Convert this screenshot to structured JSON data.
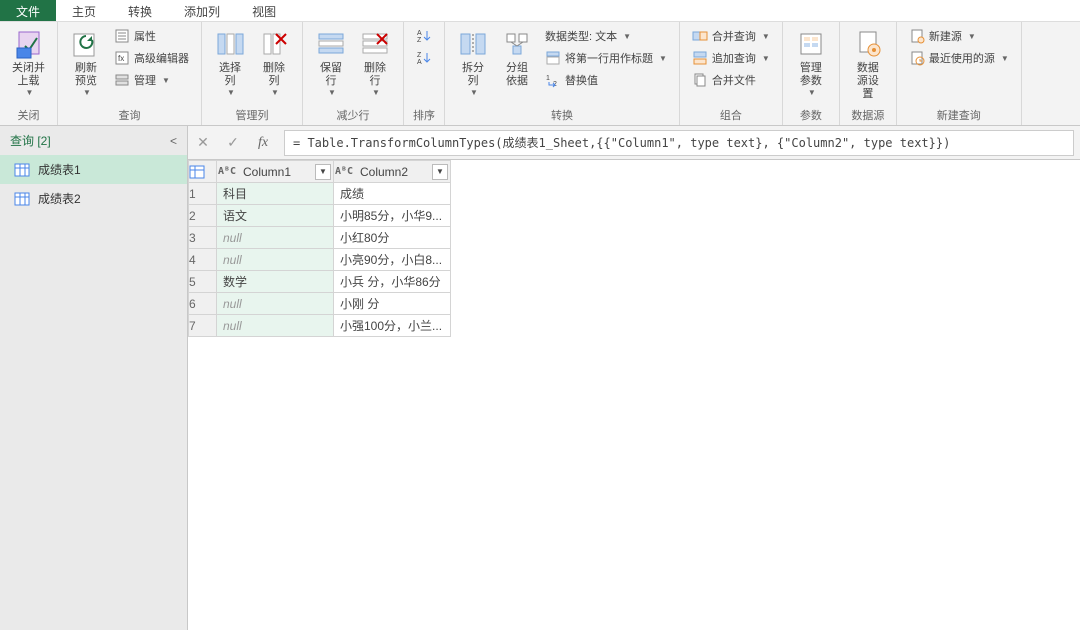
{
  "tabs": {
    "file": "文件",
    "home": "主页",
    "transform": "转换",
    "addcol": "添加列",
    "view": "视图"
  },
  "ribbon": {
    "close": {
      "btn": "关闭并\n上载",
      "label": "关闭"
    },
    "query": {
      "refresh": "刷新\n预览",
      "props": "属性",
      "advanced": "高级编辑器",
      "manage": "管理",
      "label": "查询"
    },
    "managecols": {
      "choose": "选择\n列",
      "remove": "删除\n列",
      "label": "管理列"
    },
    "reducerows": {
      "keep": "保留\n行",
      "removerows": "删除\n行",
      "label": "减少行"
    },
    "sort": {
      "label": "排序"
    },
    "transform": {
      "split": "拆分\n列",
      "group": "分组\n依据",
      "datatype": "数据类型: 文本",
      "firstrow": "将第一行用作标题",
      "replace": "替换值",
      "label": "转换"
    },
    "combine": {
      "merge": "合并查询",
      "append": "追加查询",
      "combfiles": "合并文件",
      "label": "组合"
    },
    "params": {
      "btn": "管理\n参数",
      "label": "参数"
    },
    "datasource": {
      "btn": "数据\n源设\n置",
      "label": "数据源"
    },
    "newquery": {
      "newsource": "新建源",
      "recent": "最近使用的源",
      "label": "新建查询"
    }
  },
  "queries": {
    "header": "查询 [2]",
    "items": [
      "成绩表1",
      "成绩表2"
    ]
  },
  "formula": "= Table.TransformColumnTypes(成绩表1_Sheet,{{\"Column1\", type text}, {\"Column2\", type text}})",
  "grid": {
    "columns": [
      "Column1",
      "Column2"
    ],
    "typeicon": "AᴮC",
    "rows": [
      {
        "c1": "科目",
        "c2": "成绩"
      },
      {
        "c1": "语文",
        "c2": "小明85分，小华9..."
      },
      {
        "c1": null,
        "c2": "小红80分"
      },
      {
        "c1": null,
        "c2": "小亮90分，小白8..."
      },
      {
        "c1": "数学",
        "c2": "小兵 分，小华86分"
      },
      {
        "c1": null,
        "c2": "小刚 分"
      },
      {
        "c1": null,
        "c2": "小强100分，小兰..."
      }
    ],
    "nulltext": "null"
  },
  "colors": {
    "accent": "#217346"
  }
}
